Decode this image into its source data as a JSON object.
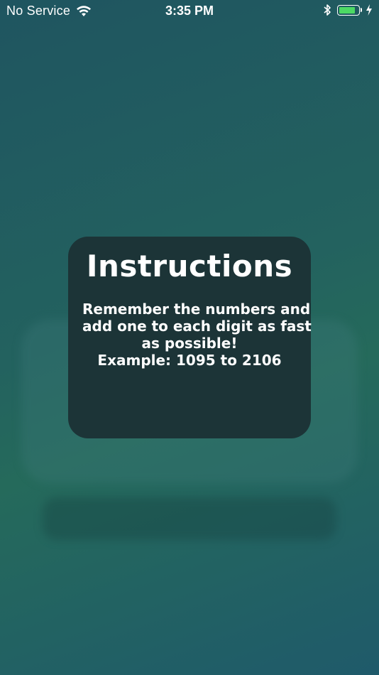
{
  "status_bar": {
    "carrier": "No Service",
    "time": "3:35 PM",
    "battery_level": 0.85,
    "battery_color": "#4cd964",
    "icons": [
      "wifi-icon",
      "bluetooth-icon",
      "battery-icon",
      "charging-icon"
    ]
  },
  "modal": {
    "title": "Instructions",
    "body_lines": [
      "Remember the numbers and",
      "add one to each digit as fast",
      "as possible!",
      "Example: 1095 to 2106"
    ],
    "background": "#1c3437"
  }
}
